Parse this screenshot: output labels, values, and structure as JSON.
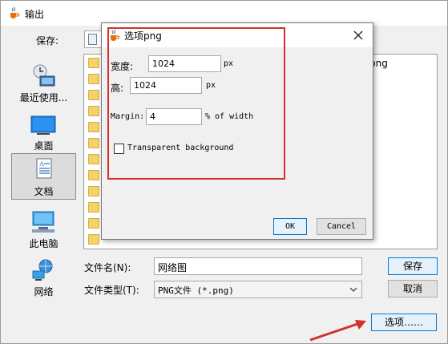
{
  "outer_dialog": {
    "title": "输出",
    "save_in_label": "保存:",
    "visible_filename_fragment": "png",
    "places": [
      {
        "label": "最近使用...",
        "icon": "recent-icon"
      },
      {
        "label": "桌面",
        "icon": "desktop-icon"
      },
      {
        "label": "文档",
        "icon": "documents-icon",
        "selected": true
      },
      {
        "label": "此电脑",
        "icon": "computer-icon"
      },
      {
        "label": "网络",
        "icon": "network-icon"
      }
    ],
    "file_name_label": "文件名(N):",
    "file_name_value": "网络图",
    "file_type_label": "文件类型(T):",
    "file_type_value": "PNG文件 (*.png)",
    "save_button": "保存",
    "cancel_button": "取消",
    "options_button": "选项……"
  },
  "options_dialog": {
    "title": "选项png",
    "width_label": "宽度:",
    "width_value": "1024",
    "width_unit": "px",
    "height_label": "高:",
    "height_value": "1024",
    "height_unit": "px",
    "margin_label": "Margin:",
    "margin_value": "4",
    "margin_unit": "% of width",
    "transparent_label": "Transparent background",
    "transparent_checked": false,
    "ok_button": "OK",
    "cancel_button": "Cancel"
  },
  "colors": {
    "annotation_red": "#d0312d",
    "default_button_border": "#0078d7",
    "folder_yellow": "#f5d26a"
  }
}
